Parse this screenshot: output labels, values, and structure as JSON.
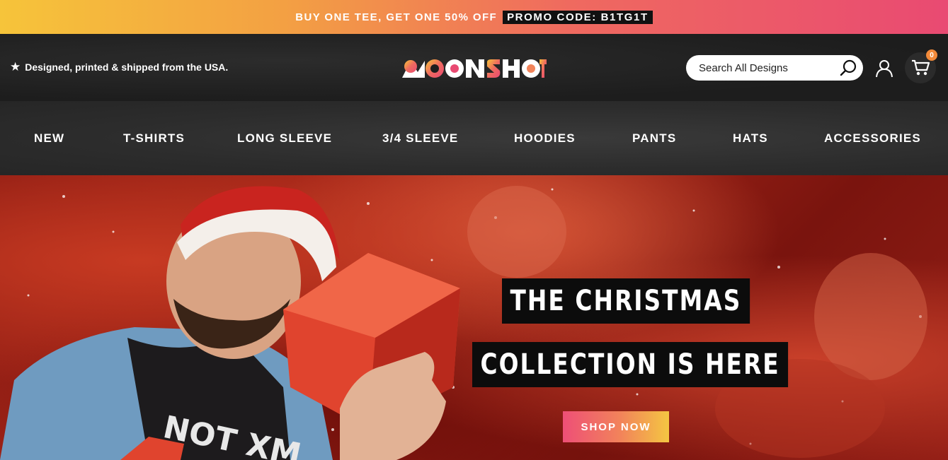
{
  "promo": {
    "text": "BUY ONE TEE, GET ONE 50% OFF",
    "code_label": "PROMO CODE: B1TG1T"
  },
  "header": {
    "tagline": "Designed, printed & shipped from the USA.",
    "tagline_icon": "star-icon",
    "logo_text": "MOONSHOT",
    "search_placeholder": "Search All Designs",
    "cart_count": "0"
  },
  "nav": {
    "items": [
      {
        "label": "NEW"
      },
      {
        "label": "T-SHIRTS"
      },
      {
        "label": "LONG SLEEVE"
      },
      {
        "label": "3/4 SLEEVE"
      },
      {
        "label": "HOODIES"
      },
      {
        "label": "PANTS"
      },
      {
        "label": "HATS"
      },
      {
        "label": "ACCESSORIES"
      }
    ]
  },
  "hero": {
    "headline_line1": "THE CHRISTMAS",
    "headline_line2": "COLLECTION IS HERE",
    "cta": "SHOP NOW",
    "shirt_text": "NOT XM"
  },
  "colors": {
    "promo_gradient": [
      "#f6c43a",
      "#ef6a5f",
      "#e94a72"
    ],
    "header_bg": "#1e1e1e",
    "nav_bg": "#2f2f2f",
    "hero_red": "#a8281a",
    "cta_gradient": [
      "#ee4f77",
      "#f2845a",
      "#f4c642"
    ]
  }
}
